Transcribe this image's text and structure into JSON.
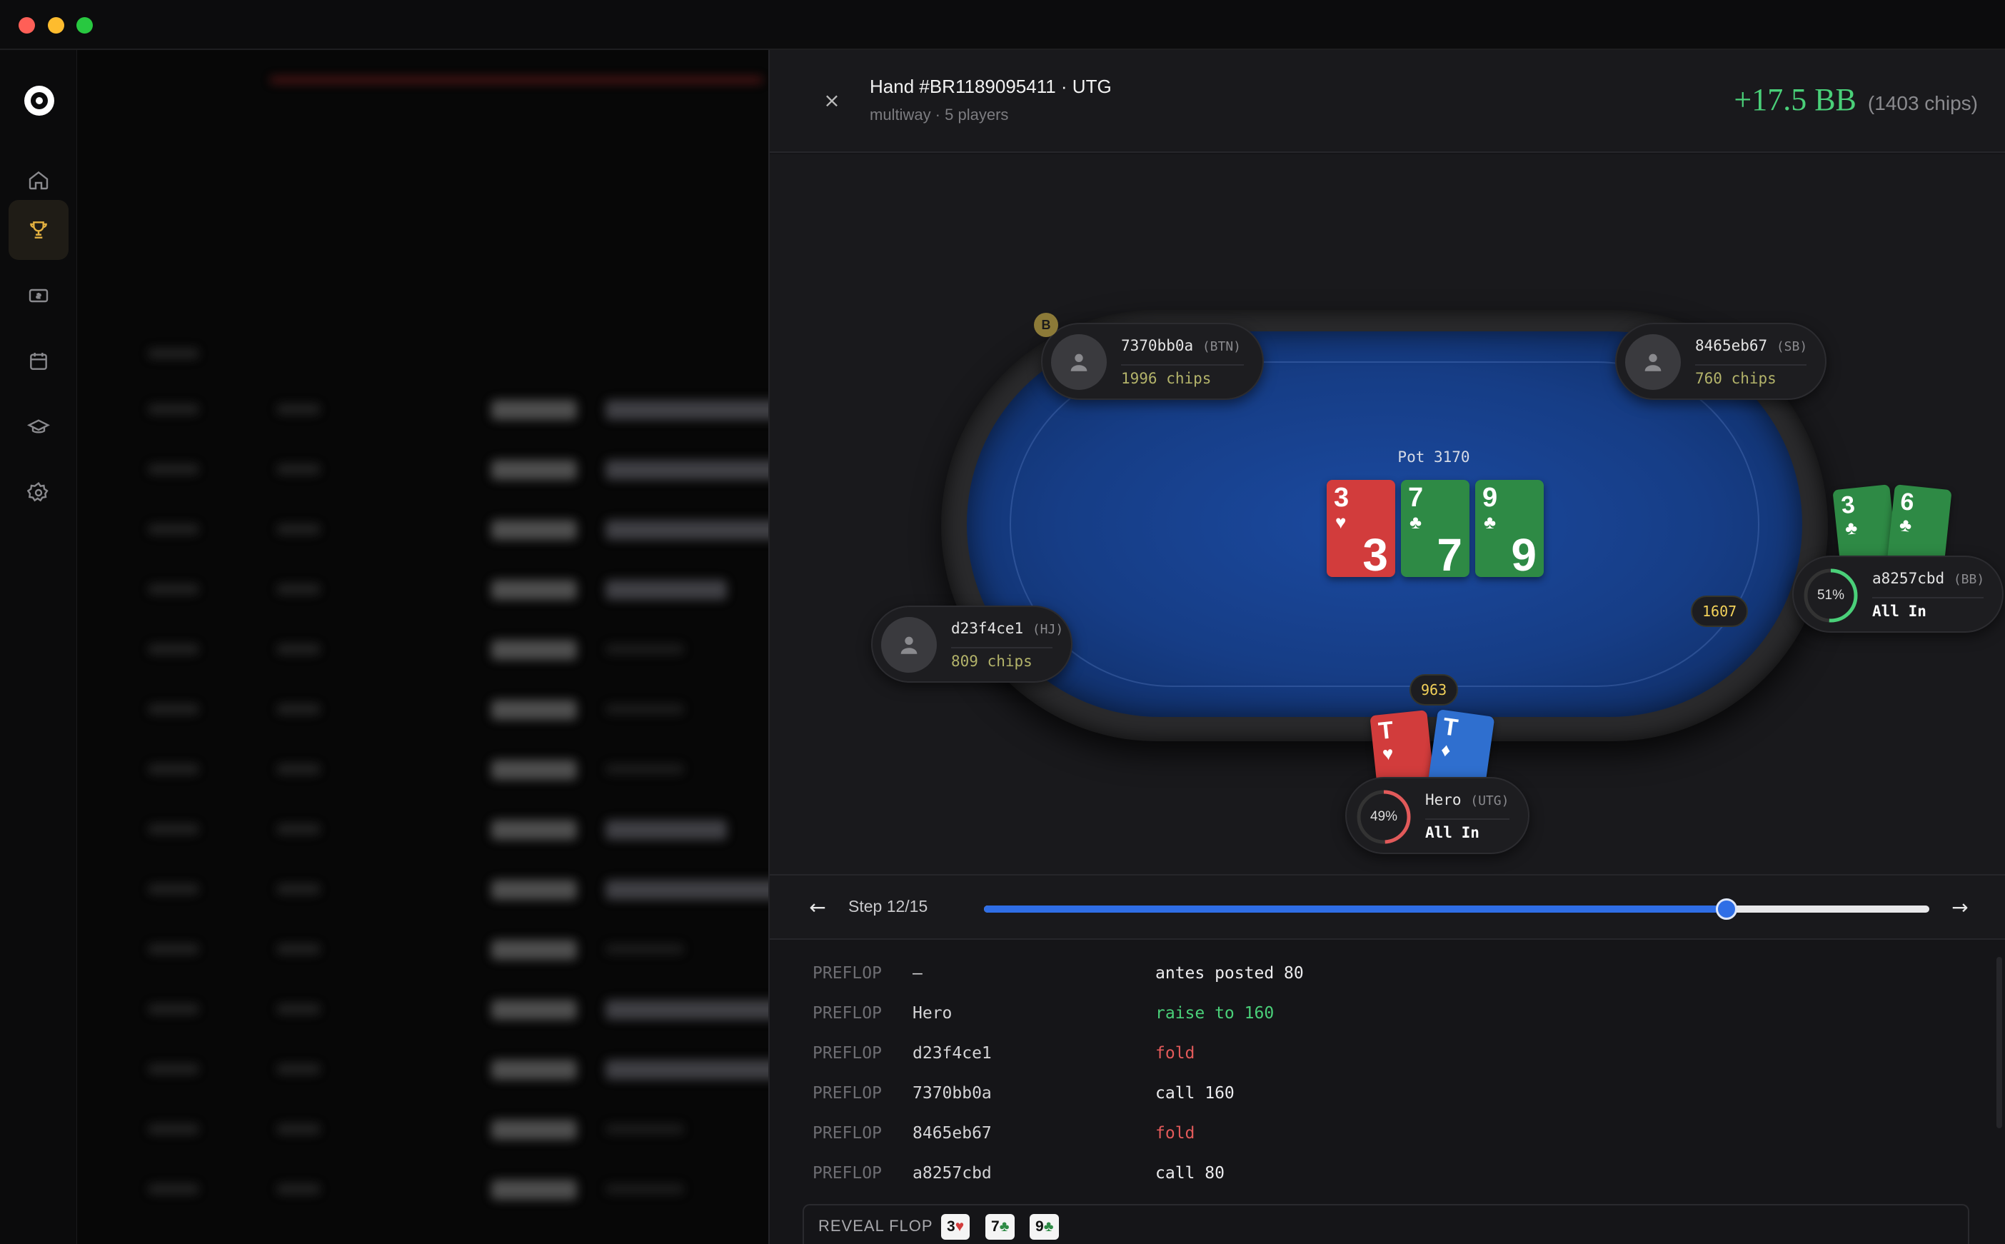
{
  "header": {
    "title": "Hand #BR1189095411 · UTG",
    "subtitle": "multiway · 5 players",
    "result_bb": "+17.5 BB",
    "result_chips": "(1403 chips)"
  },
  "table": {
    "pot": "Pot 3170",
    "board": [
      {
        "rank": "3",
        "suit": "♥",
        "color": "#d23c3c"
      },
      {
        "rank": "7",
        "suit": "♣",
        "color": "#2e8a45"
      },
      {
        "rank": "9",
        "suit": "♣",
        "color": "#2e8a45"
      }
    ],
    "dealer_button": "B",
    "seats": {
      "btn": {
        "name": "7370bb0a",
        "position": "(BTN)",
        "stack": "1996 chips"
      },
      "sb": {
        "name": "8465eb67",
        "position": "(SB)",
        "stack": "760 chips"
      },
      "hj": {
        "name": "d23f4ce1",
        "position": "(HJ)",
        "stack": "809 chips"
      },
      "bb": {
        "name": "a8257cbd",
        "position": "(BB)",
        "stack": "All In",
        "equity": "51%",
        "bet": "1607",
        "cards": [
          {
            "rank": "3",
            "suit": "♣"
          },
          {
            "rank": "6",
            "suit": "♣"
          }
        ]
      },
      "hero": {
        "name": "Hero",
        "position": "(UTG)",
        "stack": "All In",
        "equity": "49%",
        "bet": "963",
        "cards": [
          {
            "rank": "T",
            "suit": "♥"
          },
          {
            "rank": "T",
            "suit": "♦"
          }
        ]
      }
    }
  },
  "stepper": {
    "label": "Step 12/15",
    "current": 12,
    "total": 15
  },
  "log": [
    {
      "street": "PREFLOP",
      "player": "–",
      "action": "antes posted 80",
      "kind": "neutral"
    },
    {
      "street": "PREFLOP",
      "player": "Hero",
      "action": "raise to 160",
      "kind": "raise"
    },
    {
      "street": "PREFLOP",
      "player": "d23f4ce1",
      "action": "fold",
      "kind": "fold"
    },
    {
      "street": "PREFLOP",
      "player": "7370bb0a",
      "action": "call 160",
      "kind": "neutral"
    },
    {
      "street": "PREFLOP",
      "player": "8465eb67",
      "action": "fold",
      "kind": "fold"
    },
    {
      "street": "PREFLOP",
      "player": "a8257cbd",
      "action": "call 80",
      "kind": "neutral"
    }
  ],
  "reveal": {
    "label": "REVEAL FLOP",
    "cards": [
      {
        "rank": "3",
        "suit": "♥"
      },
      {
        "rank": "7",
        "suit": "♣"
      },
      {
        "rank": "9",
        "suit": "♣"
      }
    ]
  },
  "nav": {
    "items": [
      "home-icon",
      "trophy-icon",
      "cash-icon",
      "calendar-icon",
      "graduation-cap-icon",
      "gear-icon"
    ],
    "active": "trophy-icon"
  },
  "colors": {
    "accent": "#2f6ee6",
    "profit": "#4ad079",
    "fold": "#e25a5a",
    "felt": "#163d86"
  }
}
